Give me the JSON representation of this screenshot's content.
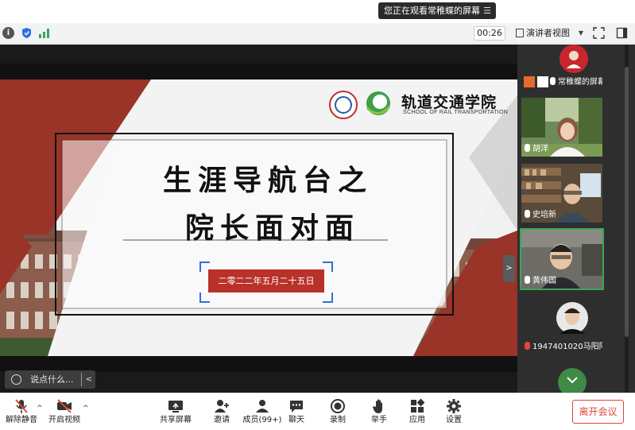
{
  "banner": {
    "text": "您正在观看常稚蝶的屏幕"
  },
  "toolbar": {
    "timer": "00:26",
    "view_mode": "演讲者视图"
  },
  "slide": {
    "school_name": "轨道交通学院",
    "school_name_en": "SCHOOL OF RAIL TRANSPORTATION",
    "title_line1": "生涯导航台之",
    "title_line2": "院长面对面",
    "date": "二零二二年五月二十五日"
  },
  "chat": {
    "placeholder": "说点什么..."
  },
  "participants": [
    {
      "name": "常稚蝶的屏幕共享"
    },
    {
      "name": "胡洋"
    },
    {
      "name": "史培新"
    },
    {
      "name": "黄伟国"
    },
    {
      "name": "1947401020马阳阳"
    }
  ],
  "bottom": {
    "mute": "解除静音",
    "video": "开启视频",
    "share": "共享屏幕",
    "invite": "邀请",
    "members": "成员(99+)",
    "chat": "聊天",
    "record": "录制",
    "raise_hand": "举手",
    "apps": "应用",
    "settings": "设置",
    "leave": "离开会议"
  },
  "colors": {
    "accent_red": "#9a3328",
    "stamp_red": "#b8322a",
    "active_green": "#3aa655",
    "leave_red": "#e2453c"
  }
}
